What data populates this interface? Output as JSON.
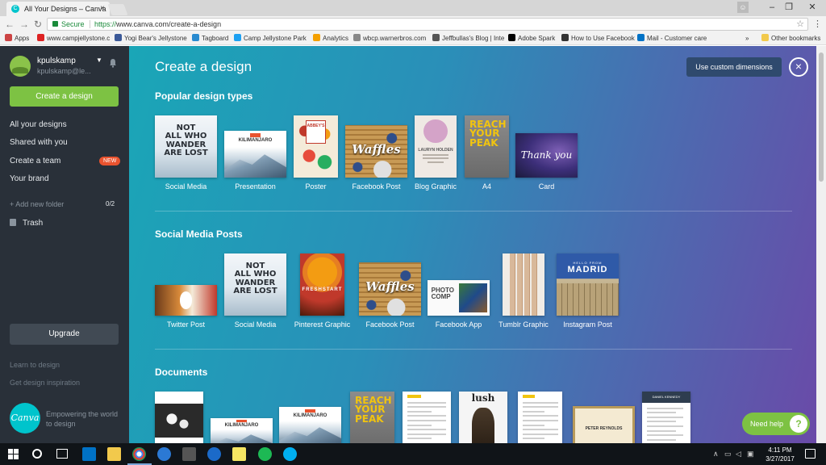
{
  "browser": {
    "tab_title": "All Your Designs – Canva",
    "tab_close": "×",
    "url_secure_label": "Secure",
    "url_scheme": "https://",
    "url_rest": "www.canva.com/create-a-design",
    "win_min": "–",
    "win_max": "❐",
    "win_close": "✕",
    "bookmarks": [
      {
        "label": "Apps",
        "color": "#c44"
      },
      {
        "label": "www.campjellystone.c",
        "color": "#d22"
      },
      {
        "label": "Yogi Bear's Jellystone",
        "color": "#3b5998"
      },
      {
        "label": "Tagboard",
        "color": "#2a8bd0"
      },
      {
        "label": "Camp Jellystone Park",
        "color": "#1da1f2"
      },
      {
        "label": "Analytics",
        "color": "#f4a000"
      },
      {
        "label": "wbcp.warnerbros.com",
        "color": "#888"
      },
      {
        "label": "Jeffbullas's Blog | Inte",
        "color": "#555"
      },
      {
        "label": "Adobe Spark",
        "color": "#000"
      },
      {
        "label": "How to Use Facebook",
        "color": "#333"
      },
      {
        "label": "Mail - Customer care",
        "color": "#0072c6"
      }
    ],
    "bookmarks_more": "»",
    "other_bookmarks": "Other bookmarks"
  },
  "sidebar": {
    "username": "kpulskamp",
    "email": "kpulskamp@le...",
    "create_button": "Create a design",
    "nav": [
      {
        "label": "All your designs"
      },
      {
        "label": "Shared with you"
      },
      {
        "label": "Create a team"
      },
      {
        "label": "Your brand"
      }
    ],
    "new_badge": "NEW",
    "add_folder": "+ Add new folder",
    "folder_count": "0/2",
    "trash": "Trash",
    "upgrade": "Upgrade",
    "learn": "Learn to design",
    "inspiration": "Get design inspiration",
    "logo_text": "Canva",
    "tagline": "Empowering the world to design"
  },
  "main": {
    "title": "Create a design",
    "custom_dimensions": "Use custom dimensions",
    "close": "×",
    "sections": [
      {
        "title": "Popular design types",
        "items": [
          {
            "label": "Social Media",
            "art": "NOT\nALL WHO\nWANDER\nARE LOST"
          },
          {
            "label": "Presentation",
            "art": "KILIMANJARO"
          },
          {
            "label": "Poster",
            "art": "ABBEY'S"
          },
          {
            "label": "Facebook Post",
            "art": "Waffles"
          },
          {
            "label": "Blog Graphic",
            "art": "LAURYN HOLDEN"
          },
          {
            "label": "A4",
            "art": "REACH\nYOUR\nPEAK"
          },
          {
            "label": "Card",
            "art": "Thank you"
          }
        ]
      },
      {
        "title": "Social Media Posts",
        "items": [
          {
            "label": "Twitter Post",
            "art": ""
          },
          {
            "label": "Social Media",
            "art": "NOT\nALL WHO\nWANDER\nARE LOST"
          },
          {
            "label": "Pinterest Graphic",
            "art": "FRESHSTART"
          },
          {
            "label": "Facebook Post",
            "art": "Waffles"
          },
          {
            "label": "Facebook App",
            "art": "PHOTO\nCOMP"
          },
          {
            "label": "Tumblr Graphic",
            "art": ""
          },
          {
            "label": "Instagram Post",
            "art": "MADRID",
            "art_sub": "HELLO FROM"
          }
        ]
      },
      {
        "title": "Documents",
        "items": [
          {
            "label": "",
            "art": ""
          },
          {
            "label": "",
            "art": "KILIMANJARO"
          },
          {
            "label": "",
            "art": "KILIMANJARO"
          },
          {
            "label": "",
            "art": "REACH\nYOUR\nPEAK"
          },
          {
            "label": "",
            "art": ""
          },
          {
            "label": "",
            "art": "lush"
          },
          {
            "label": "",
            "art": ""
          },
          {
            "label": "",
            "art": "PETER REYNOLDS"
          },
          {
            "label": "",
            "art": "DANIEL KENNEDY"
          }
        ]
      }
    ]
  },
  "help": {
    "label": "Need help",
    "icon": "?"
  },
  "taskbar": {
    "time": "4:11 PM",
    "date": "3/27/2017"
  },
  "colors": {
    "accent_green": "#7dc243",
    "sidebar_bg": "#293039",
    "badge_red": "#e9532f"
  }
}
